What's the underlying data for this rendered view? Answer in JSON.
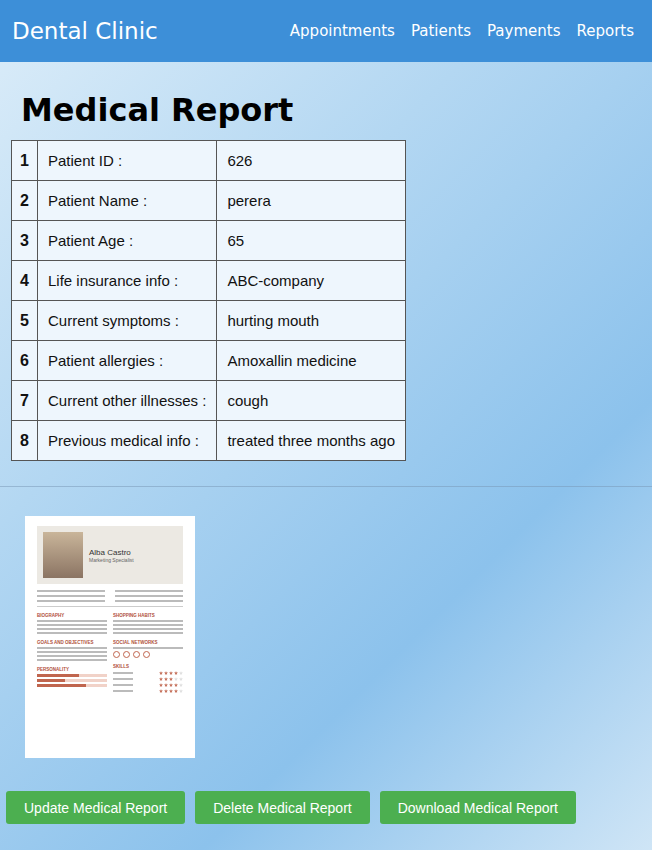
{
  "nav": {
    "brand": "Dental Clinic",
    "links": [
      "Appointments",
      "Patients",
      "Payments",
      "Reports"
    ]
  },
  "report": {
    "title": "Medical Report",
    "rows": [
      {
        "no": "1",
        "label": "Patient ID :",
        "value": "626"
      },
      {
        "no": "2",
        "label": "Patient Name :",
        "value": "perera"
      },
      {
        "no": "3",
        "label": "Patient Age :",
        "value": "65"
      },
      {
        "no": "4",
        "label": "Life insurance info :",
        "value": "ABC-company"
      },
      {
        "no": "5",
        "label": "Current symptoms :",
        "value": "hurting mouth"
      },
      {
        "no": "6",
        "label": "Patient allergies :",
        "value": "Amoxallin medicine"
      },
      {
        "no": "7",
        "label": "Current other illnesses :",
        "value": "cough"
      },
      {
        "no": "8",
        "label": "Previous medical info :",
        "value": "treated three months ago"
      }
    ]
  },
  "document": {
    "name": "Alba Castro",
    "role": "Marketing Specialist",
    "left_sections": [
      "BIOGRAPHY",
      "GOALS AND OBJECTIVES",
      "PERSONALITY"
    ],
    "right_sections": [
      "SHOPPING HABITS",
      "SOCIAL NETWORKS",
      "SKILLS"
    ],
    "personality": [
      {
        "level": 0.6
      },
      {
        "level": 0.4
      },
      {
        "level": 0.7
      }
    ],
    "skills": [
      {
        "stars": 4
      },
      {
        "stars": 3
      },
      {
        "stars": 4
      },
      {
        "stars": 4
      }
    ]
  },
  "buttons": [
    "Update Medical Report",
    "Delete Medical Report",
    "Download Medical Report"
  ]
}
